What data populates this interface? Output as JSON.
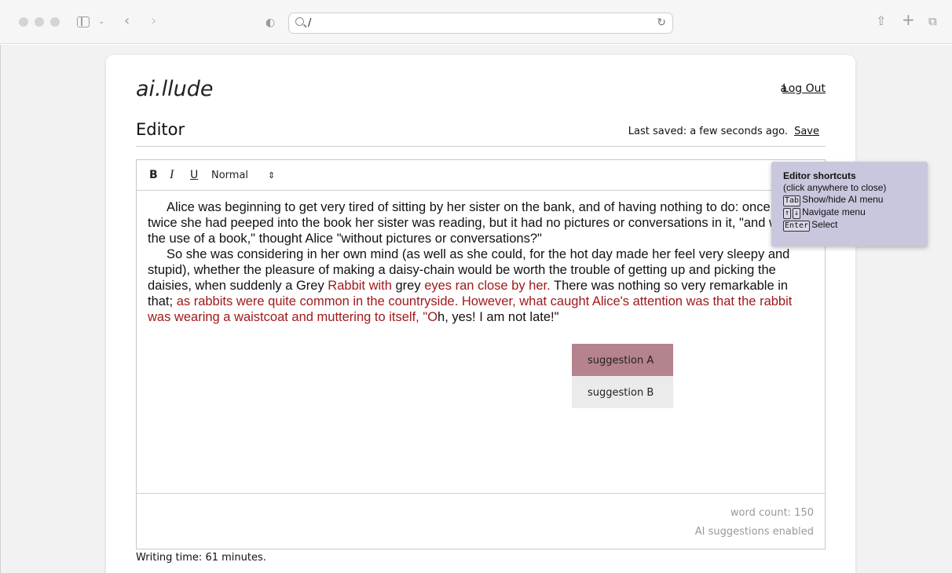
{
  "browser": {
    "url": "/",
    "toolbar_icons": [
      "sidebar-toggle-icon",
      "back-icon",
      "forward-icon",
      "shield-icon",
      "reload-icon",
      "share-icon",
      "new-tab-icon",
      "tabs-overview-icon"
    ]
  },
  "header": {
    "logo": "ai.llude",
    "username": "a",
    "logout_label": "Log Out"
  },
  "editor": {
    "heading": "Editor",
    "last_saved": "Last saved: a few seconds ago.",
    "save_label": "Save",
    "toolbar": {
      "bold": "B",
      "italic": "I",
      "underline": "U",
      "format": "Normal",
      "format_arrow": "⇕"
    },
    "paragraph1": "Alice was beginning to get very tired of sitting by her sister on the bank, and of having nothing to do: once or twice she had peeped into the book her sister was reading, but it had no pictures or conversations in it, \"and what is the use of a book,\" thought Alice \"without pictures or conversations?\"",
    "p2_a": "So she was considering in her own mind (as well as she could, for the hot day made her feel very sleepy and stupid), whether the pleasure of making a daisy-chain would be worth the trouble of getting up and picking the daisies, when suddenly a Grey ",
    "p2_b": "Rabbit with",
    "p2_c": " grey ",
    "p2_d": "eyes ran close by her.",
    "p2_e": " There was nothing so very remarkable in that;",
    "p2_f": " as rabbits were quite common in the countryside. However, what caught Alice's attention was that the rabbit was wearing a waistcoat and muttering to itself, \"O",
    "p2_g": "h, yes! I am not late!\"",
    "word_count": "word count: 150",
    "ai_status": "AI suggestions enabled",
    "writing_time": "Writing time: 61 minutes."
  },
  "suggestions": [
    {
      "label": "suggestion A",
      "selected": true
    },
    {
      "label": "suggestion B",
      "selected": false
    }
  ],
  "shortcuts": {
    "title": "Editor shortcuts",
    "subtitle": "(click anywhere to close)",
    "tab_key": "Tab",
    "tab_desc": "Show/hide AI menu",
    "up_key": "↑",
    "down_key": "↓",
    "nav_desc": "Navigate menu",
    "enter_key": "Enter",
    "enter_desc": "Select"
  },
  "colors": {
    "ai_text": "#a0191c",
    "suggestion_active": "#b5838d",
    "shortcuts_bg": "#c9c7dd"
  }
}
